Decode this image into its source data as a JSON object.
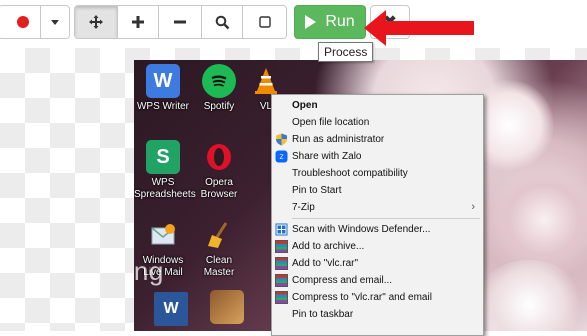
{
  "toolbar": {
    "run_label": "Run",
    "close_symbol": "✖",
    "tooltip": "Process"
  },
  "desktop": {
    "icons": [
      {
        "label": "WPS Writer",
        "glyph": "W"
      },
      {
        "label": "Spotify",
        "glyph": ""
      },
      {
        "label": "VL",
        "glyph": ""
      },
      {
        "label": "WPS Spreadsheets",
        "glyph": "S"
      },
      {
        "label": "Opera Browser",
        "glyph": "O"
      },
      {
        "label": "Windows Live Mail",
        "glyph": ""
      },
      {
        "label": "Clean Master",
        "glyph": ""
      }
    ]
  },
  "context_menu": {
    "items": [
      {
        "label": "Open",
        "bold": true
      },
      {
        "label": "Open file location"
      },
      {
        "label": "Run as administrator",
        "icon": "shield-icon"
      },
      {
        "label": "Share with Zalo",
        "icon": "zalo-icon"
      },
      {
        "label": "Troubleshoot compatibility"
      },
      {
        "label": "Pin to Start"
      },
      {
        "label": "7-Zip",
        "submenu": true
      },
      {
        "label": "Scan with Windows Defender...",
        "icon": "defender-icon"
      },
      {
        "label": "Add to archive...",
        "icon": "winrar-icon"
      },
      {
        "label": "Add to \"vlc.rar\"",
        "icon": "winrar-icon"
      },
      {
        "label": "Compress and email...",
        "icon": "winrar-icon"
      },
      {
        "label": "Compress to \"vlc.rar\" and email",
        "icon": "winrar-icon"
      },
      {
        "label": "Pin to taskbar"
      }
    ],
    "submenu_arrow": "›"
  },
  "watermark": "Quantrimang",
  "colors": {
    "run_green": "#5cb85c",
    "record_red": "#e02020",
    "arrow_red": "#e8161c"
  }
}
